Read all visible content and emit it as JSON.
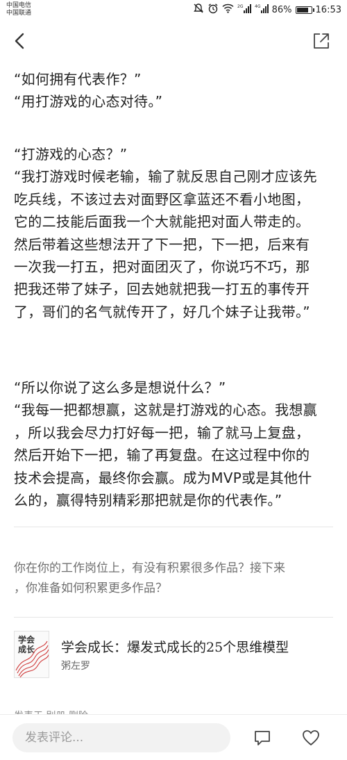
{
  "status_bar": {
    "carrier_1": "中国电信",
    "carrier_2": "中国联通",
    "signal_1": "2G",
    "signal_2": "4G",
    "battery": "86%",
    "battery_level": 0.86,
    "time": "16:53"
  },
  "nav": {
    "back_icon": "chevron-left-icon",
    "share_icon": "share-icon"
  },
  "article": {
    "paragraphs": [
      [
        "“如何拥有代表作？”",
        "“用打游戏的心态对待。”"
      ],
      [
        "“打游戏的心态？”",
        "“我打游戏时候老输，输了就反思自己刚才应该先",
        "吃兵线，不该过去对面野区拿蓝还不看小地图，",
        "它的二技能后面我一个大就能把对面人带走的。",
        "然后带着这些想法开了下一把，下一把，后来有",
        "一次我一打五，把对面团灭了，你说巧不巧，那",
        "把我还带了妹子，回去她就把我一打五的事传开",
        "了，哥们的名气就传开了，好几个妹子让我带。”"
      ],
      [
        "“所以你说了这么多是想说什么？”",
        "“我每一把都想赢，这就是打游戏的心态。我想赢",
        "，所以我会尽力打好每一把，输了就马上复盘，",
        "然后开始下一把，输了再复盘。在这过程中你的",
        "技术会提高，最终你会赢。成为MVP或是其他什",
        "么的，赢得特别精彩那把就是你的代表作。”"
      ]
    ],
    "question": [
      "你在你的工作岗位上，有没有积累很多作品？接下来",
      "，你准备如何积累更多作品？"
    ]
  },
  "book": {
    "title": "学会成长：爆发式成长的25个思维模型",
    "author": "粥左罗",
    "cover_text": [
      "学会",
      "成长"
    ]
  },
  "peek_text": "发表于 别册 删除",
  "bottom_bar": {
    "comment_placeholder": "发表评论...",
    "comment_icon": "comment-icon",
    "like_icon": "heart-icon"
  }
}
